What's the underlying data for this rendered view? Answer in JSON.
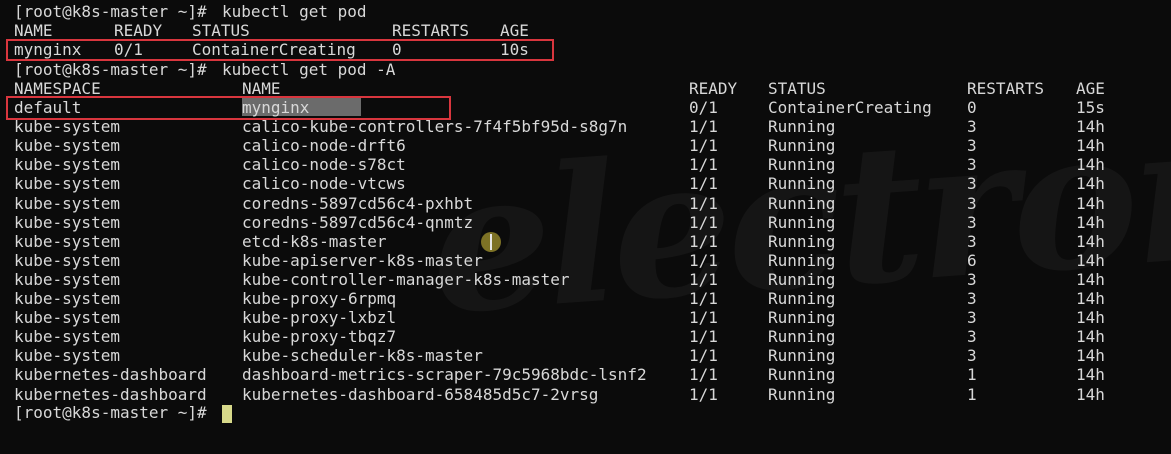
{
  "prompt": "[root@k8s-master ~]# ",
  "command1": "kubectl get pod",
  "table1": {
    "headers": [
      "NAME",
      "READY",
      "STATUS",
      "RESTARTS",
      "AGE"
    ],
    "rows": [
      [
        "mynginx",
        "0/1",
        "ContainerCreating",
        "0",
        "10s"
      ]
    ]
  },
  "command2": "kubectl get pod -A",
  "table2": {
    "headers": [
      "NAMESPACE",
      "NAME",
      "READY",
      "STATUS",
      "RESTARTS",
      "AGE"
    ],
    "rows": [
      [
        "default",
        "mynginx",
        "0/1",
        "ContainerCreating",
        "0",
        "15s"
      ],
      [
        "kube-system",
        "calico-kube-controllers-7f4f5bf95d-s8g7n",
        "1/1",
        "Running",
        "3",
        "14h"
      ],
      [
        "kube-system",
        "calico-node-drft6",
        "1/1",
        "Running",
        "3",
        "14h"
      ],
      [
        "kube-system",
        "calico-node-s78ct",
        "1/1",
        "Running",
        "3",
        "14h"
      ],
      [
        "kube-system",
        "calico-node-vtcws",
        "1/1",
        "Running",
        "3",
        "14h"
      ],
      [
        "kube-system",
        "coredns-5897cd56c4-pxhbt",
        "1/1",
        "Running",
        "3",
        "14h"
      ],
      [
        "kube-system",
        "coredns-5897cd56c4-qnmtz",
        "1/1",
        "Running",
        "3",
        "14h"
      ],
      [
        "kube-system",
        "etcd-k8s-master",
        "1/1",
        "Running",
        "3",
        "14h"
      ],
      [
        "kube-system",
        "kube-apiserver-k8s-master",
        "1/1",
        "Running",
        "6",
        "14h"
      ],
      [
        "kube-system",
        "kube-controller-manager-k8s-master",
        "1/1",
        "Running",
        "3",
        "14h"
      ],
      [
        "kube-system",
        "kube-proxy-6rpmq",
        "1/1",
        "Running",
        "3",
        "14h"
      ],
      [
        "kube-system",
        "kube-proxy-lxbzl",
        "1/1",
        "Running",
        "3",
        "14h"
      ],
      [
        "kube-system",
        "kube-proxy-tbqz7",
        "1/1",
        "Running",
        "3",
        "14h"
      ],
      [
        "kube-system",
        "kube-scheduler-k8s-master",
        "1/1",
        "Running",
        "3",
        "14h"
      ],
      [
        "kubernetes-dashboard",
        "dashboard-metrics-scraper-79c5968bdc-lsnf2",
        "1/1",
        "Running",
        "1",
        "14h"
      ],
      [
        "kubernetes-dashboard",
        "kubernetes-dashboard-658485d5c7-2vrsg",
        "1/1",
        "Running",
        "1",
        "14h"
      ]
    ]
  },
  "watermark": "electron",
  "colors": {
    "background": "#0b0b0b",
    "text": "#d8d8d8",
    "highlight_box": "#d9363e",
    "selection": "#6b6b6b",
    "cursor": "#d7d98a"
  }
}
